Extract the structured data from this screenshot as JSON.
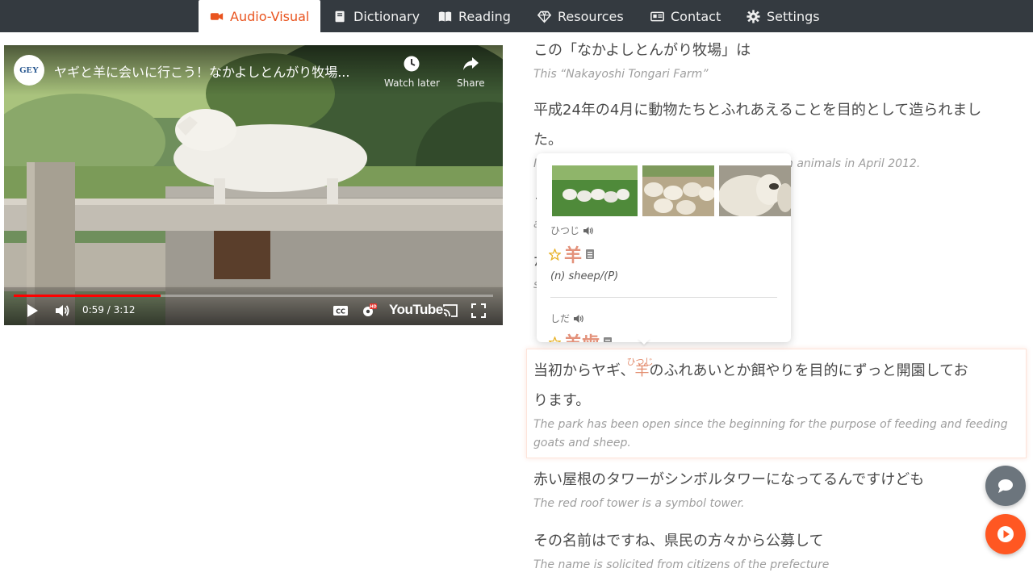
{
  "nav": {
    "items": [
      {
        "label": "Audio-Visual",
        "icon": "video-camera-icon",
        "active": true
      },
      {
        "label": "Dictionary",
        "icon": "book-icon"
      },
      {
        "label": "Reading",
        "icon": "open-book-icon"
      },
      {
        "label": "Resources",
        "icon": "diamond-icon"
      },
      {
        "label": "Contact",
        "icon": "id-card-icon"
      },
      {
        "label": "Settings",
        "icon": "gear-icon"
      }
    ],
    "accent": "#e9541f",
    "bar_color": "#343a40"
  },
  "video": {
    "channel_logo_text": "GEY",
    "title": "ヤギと羊に会いに行こう！なかよしとんがり牧場...",
    "watch_later_label": "Watch later",
    "share_label": "Share",
    "time": "0:59 / 3:12",
    "progress_fraction": 0.307,
    "youtube_label": "YouTube"
  },
  "transcript": [
    {
      "jp": "この「なかよしとんがり牧場」は",
      "en": "This “Nakayoshi Tongari Farm”"
    },
    {
      "jp": "平成24年の4月に動物たちとふれあえることを目的として造られました。",
      "en": "It was built for the purpose of interacting with animals in April 2012."
    },
    {
      "jp": "うために造られた施設で",
      "en": "anding of livestock"
    },
    {
      "jp": "か畜産に関係ある動物たちに",
      "en": "sheep, and animals related to animal"
    },
    {
      "jp_before": "当初からヤギ、",
      "jp_highlight": "羊",
      "jp_ruby": "ひつじ",
      "jp_after": "のふれあいとか餌やりを目的にずっと開園しております。",
      "en": "The park has been open since the beginning for the purpose of feeding and feeding goats and sheep."
    },
    {
      "jp": "赤い屋根のタワーがシンボルタワーになってるんですけども",
      "en": "The red roof tower is a symbol tower."
    },
    {
      "jp": "その名前はですね、県民の方々から公募して",
      "en": "The name is solicited from citizens of the prefecture"
    }
  ],
  "popup": {
    "entry1": {
      "kana": "ひつじ",
      "kanji": "羊",
      "gloss": "(n) sheep/(P)"
    },
    "entry2": {
      "kana": "しだ",
      "kanji": "羊歯"
    }
  },
  "fabs": {
    "chat_color": "#6c757d",
    "play_color": "#ff5722"
  }
}
